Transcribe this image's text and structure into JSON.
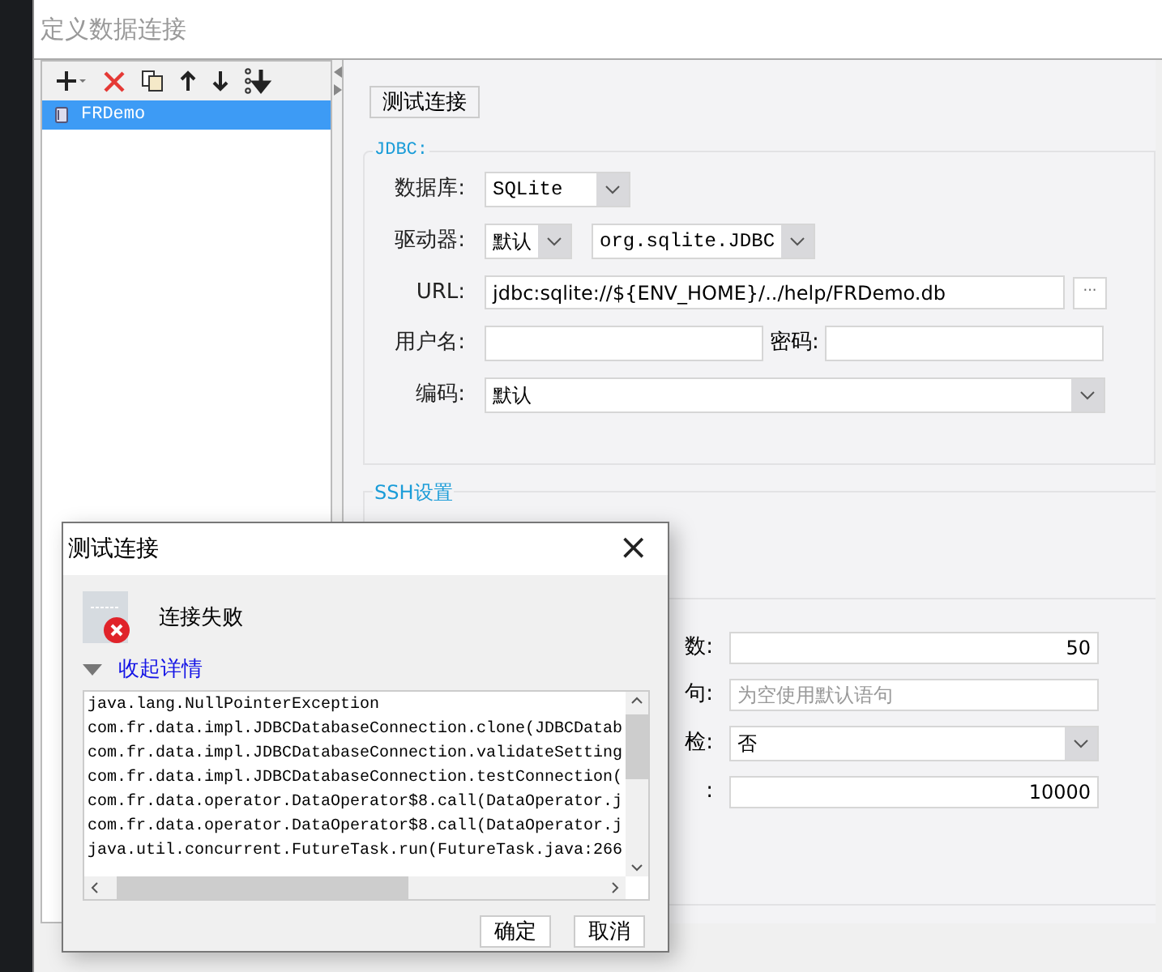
{
  "window": {
    "title": "定义数据连接"
  },
  "sidebar": {
    "items": [
      {
        "label": "FRDemo",
        "selected": true
      }
    ]
  },
  "test_button": "测试连接",
  "jdbc": {
    "legend": "JDBC:",
    "database": {
      "label": "数据库:",
      "value": "SQLite"
    },
    "driver": {
      "label": "驱动器:",
      "mode": "默认",
      "value": "org.sqlite.JDBC"
    },
    "url": {
      "label": "URL:",
      "value": "jdbc:sqlite://${ENV_HOME}/../help/FRDemo.db",
      "browse": "···"
    },
    "username": {
      "label": "用户名:"
    },
    "password": {
      "label": "密码:"
    },
    "encoding": {
      "label": "编码:",
      "value": "默认"
    }
  },
  "ssh": {
    "legend": "SSH设置"
  },
  "pool": {
    "rows": [
      {
        "kind": "number",
        "label": "数:",
        "value": "50"
      },
      {
        "kind": "text",
        "label": "句:",
        "placeholder": "为空使用默认语句"
      },
      {
        "kind": "select",
        "label": "检:",
        "value": "否"
      },
      {
        "kind": "number",
        "label": ":",
        "value": "10000"
      }
    ]
  },
  "dialog": {
    "title": "测试连接",
    "close": "×",
    "message": "连接失败",
    "details_link": "收起详情",
    "details_expanded": true,
    "log": [
      "java.lang.NullPointerException",
      "com.fr.data.impl.JDBCDatabaseConnection.clone(JDBCDatab",
      "com.fr.data.impl.JDBCDatabaseConnection.validateSetting",
      "com.fr.data.impl.JDBCDatabaseConnection.testConnection(",
      "com.fr.data.operator.DataOperator$8.call(DataOperator.j",
      "com.fr.data.operator.DataOperator$8.call(DataOperator.j",
      "java.util.concurrent.FutureTask.run(FutureTask.java:266"
    ],
    "buttons": [
      "确定",
      "取消"
    ]
  }
}
